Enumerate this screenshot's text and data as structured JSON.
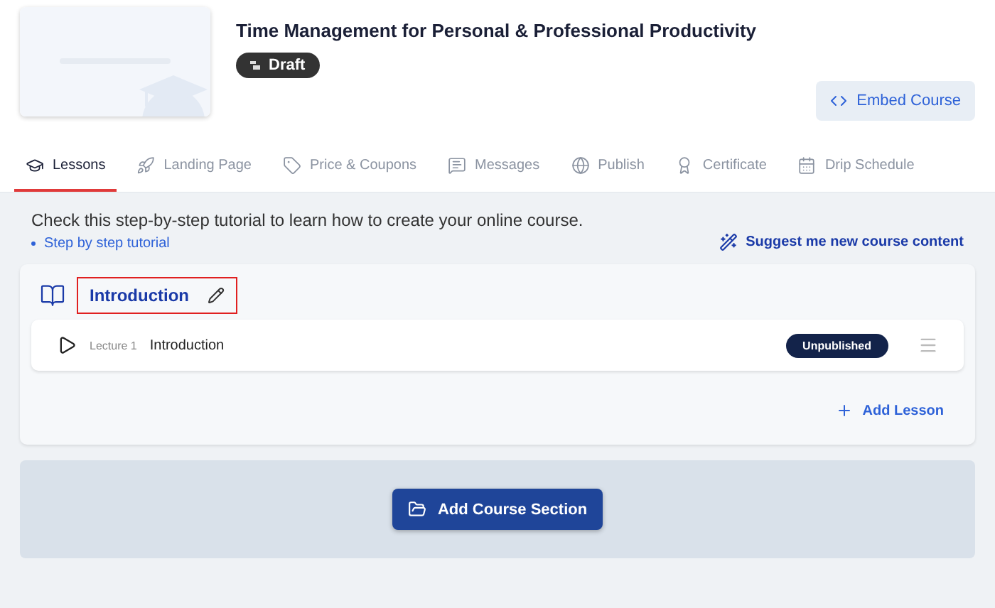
{
  "course": {
    "title": "Time Management for Personal & Professional Productivity",
    "status": "Draft"
  },
  "embed_button": "Embed Course",
  "tabs": [
    {
      "label": "Lessons",
      "selected": true
    },
    {
      "label": "Landing Page",
      "selected": false
    },
    {
      "label": "Price & Coupons",
      "selected": false
    },
    {
      "label": "Messages",
      "selected": false
    },
    {
      "label": "Publish",
      "selected": false
    },
    {
      "label": "Certificate",
      "selected": false
    },
    {
      "label": "Drip Schedule",
      "selected": false
    }
  ],
  "tutorial": {
    "text": "Check this step-by-step tutorial to learn how to create your online course.",
    "link": "Step by step tutorial"
  },
  "suggest_link": "Suggest me new course content",
  "sections": [
    {
      "title": "Introduction",
      "highlighted": true,
      "lectures": [
        {
          "number": "Lecture 1",
          "title": "Introduction",
          "status": "Unpublished"
        }
      ],
      "add_lesson": "Add Lesson"
    }
  ],
  "add_section_button": "Add Course Section"
}
